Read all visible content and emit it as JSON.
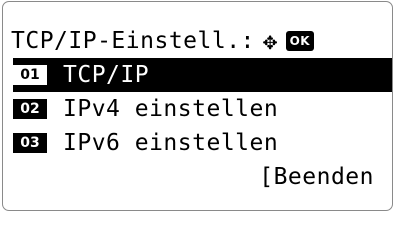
{
  "header": {
    "title": "TCP/IP-Einstell.:",
    "nav_icon": "four-way-arrow-icon",
    "ok_label": "OK"
  },
  "menu": {
    "items": [
      {
        "number": "01",
        "label": "TCP/IP",
        "selected": true
      },
      {
        "number": "02",
        "label": "IPv4 einstellen",
        "selected": false
      },
      {
        "number": "03",
        "label": "IPv6 einstellen",
        "selected": false
      }
    ]
  },
  "footer": {
    "exit_label": "[Beenden"
  },
  "colors": {
    "foreground": "#000000",
    "background": "#ffffff",
    "selected_background": "#000000",
    "selected_foreground": "#ffffff"
  }
}
